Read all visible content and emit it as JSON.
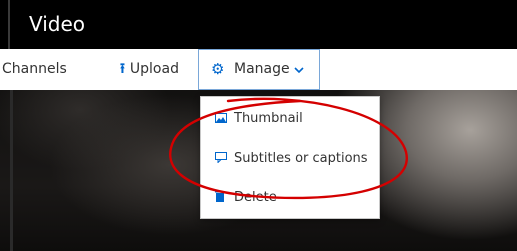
{
  "header": {
    "title": "Video"
  },
  "toolbar": {
    "channels_label": "Channels",
    "upload_label": "Upload",
    "upload_icon": "upload-icon",
    "manage_label": "Manage",
    "manage_icon": "gear-icon"
  },
  "menu": {
    "items": [
      {
        "label": "Thumbnail",
        "icon": "image-icon"
      },
      {
        "label": "Subtitles or captions",
        "icon": "caption-icon"
      },
      {
        "label": "Delete",
        "icon": "trash-icon"
      }
    ]
  },
  "colors": {
    "accent": "#0066cc",
    "annotation": "#d40000"
  }
}
